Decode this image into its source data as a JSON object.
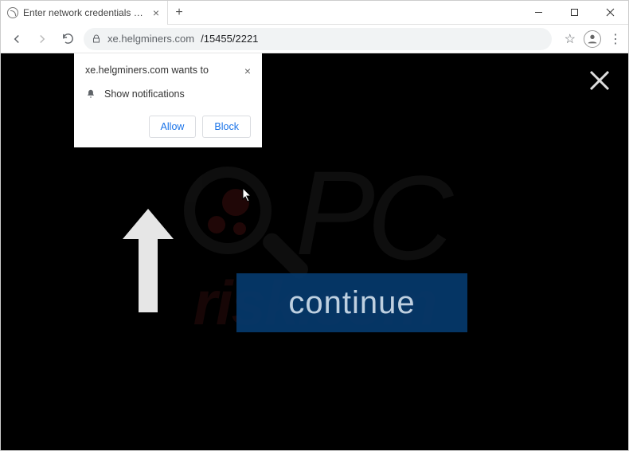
{
  "window": {
    "tab_title": "Enter network credentials windo",
    "minimize": "–",
    "maximize": "□",
    "close": "×",
    "newtab": "+"
  },
  "toolbar": {
    "url_host": "xe.helgminers.com",
    "url_path": "/15455/2221",
    "star": "☆",
    "menu": "⋮"
  },
  "permission": {
    "site": "xe.helgminers.com wants to",
    "request": "Show notifications",
    "allow": "Allow",
    "block": "Block"
  },
  "page": {
    "continue": "continue"
  },
  "watermark": {
    "pc_p": "P",
    "pc_c": "C",
    "risk": "risk.com"
  }
}
